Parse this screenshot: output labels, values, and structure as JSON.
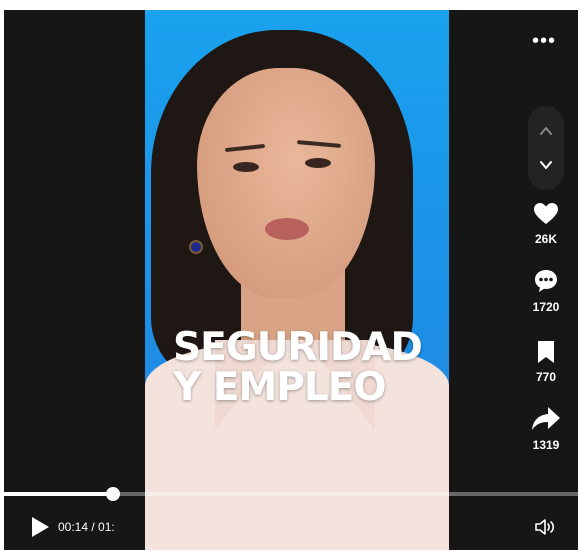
{
  "video": {
    "caption_line1": "SEGURIDAD",
    "caption_line2": "Y EMPLEO"
  },
  "rail": {
    "more_label": "•••",
    "prev_icon": "chevron-up-icon",
    "next_icon": "chevron-down-icon",
    "likes": "26K",
    "comments": "1720",
    "saves": "770",
    "shares": "1319"
  },
  "controls": {
    "time_text": "00:14 / 01:",
    "progress": 0.19,
    "play_icon": "play-icon",
    "volume_icon": "volume-icon"
  },
  "colors": {
    "player_bg": "#161616",
    "video_bg": "#1aa2ee",
    "accent": "#ffffff"
  }
}
